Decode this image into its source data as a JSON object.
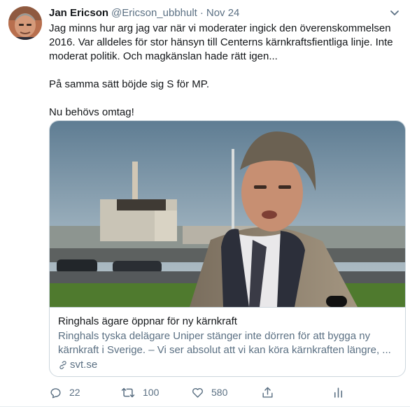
{
  "tweet": {
    "author_name": "Jan Ericson",
    "author_handle": "@Ericson_ubbhult",
    "separator": "·",
    "date": "Nov 24",
    "text_lines": [
      "Jag minns hur arg jag var när vi moderater ingick den överenskommelsen 2016. Var alldeles för stor hänsyn till Centerns kärnkraftsfientliga linje. Inte moderat politik. Och magkänslan hade rätt igen...",
      "På samma sätt böjde sig S för MP.",
      "Nu behövs omtag!"
    ]
  },
  "card": {
    "title": "Ringhals ägare öppnar för ny kärnkraft",
    "description": "Ringhals tyska delägare Uniper stänger inte dörren för att bygga ny kärnkraft i Sverige. – Vi ser absolut att vi kan köra kärnkraften längre, ...",
    "domain": "svt.se"
  },
  "actions": {
    "reply_count": "22",
    "retweet_count": "100",
    "like_count": "580"
  },
  "icons": {
    "more": "chevron-down-icon",
    "reply": "reply-icon",
    "retweet": "retweet-icon",
    "like": "heart-icon",
    "share": "share-icon",
    "analytics": "analytics-icon",
    "link": "link-icon"
  },
  "colors": {
    "secondary_text": "#5b7083",
    "border": "#ccd6dd"
  }
}
